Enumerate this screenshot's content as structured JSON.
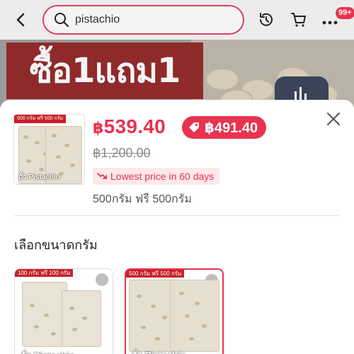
{
  "header": {
    "search_value": "pistachio",
    "cart_badge": "99+",
    "icons": [
      "back-arrow-icon",
      "search-icon",
      "history-icon",
      "cart-icon",
      "more-icon"
    ]
  },
  "banner": {
    "promo_text": "ซื้อ1แถม1"
  },
  "product": {
    "thumbnail_tag": "500 กรัม ฟรี 500 กรัม",
    "thumbnail_label": "ถั่ว Pistachio",
    "currency": "฿",
    "price": "539.40",
    "coupon_price": "฿491.40",
    "original_price": "฿1,200.00",
    "lowest_price_badge": "Lowest price in 60 days",
    "selected_variant": "500กรัม ฟรี 500กรัม"
  },
  "section": {
    "title": "เลือกขนาดกรัม"
  },
  "options": [
    {
      "tag": "100 กรัม ฟรี 100 กรัม",
      "label": "ถั่ว Pistachio",
      "selected": false
    },
    {
      "tag": "500 กรัม ฟรี 500 กรัม",
      "label": "ถั่ว Pistachio",
      "selected": true
    }
  ],
  "colors": {
    "accent": "#e8334f",
    "accent_light": "#fde8ea",
    "promo_red": "#c8202a"
  }
}
